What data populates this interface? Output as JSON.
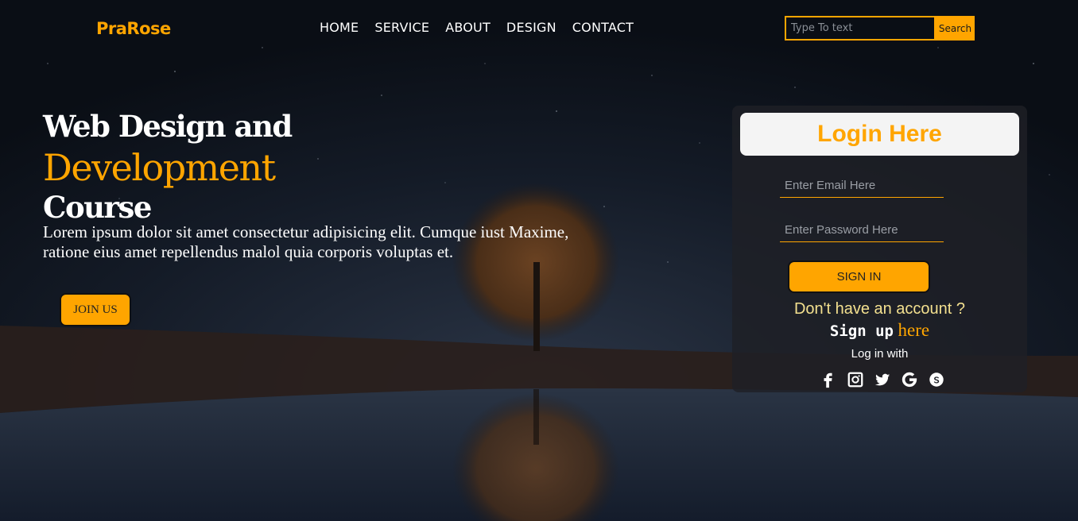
{
  "brand": {
    "logo": "PraRose",
    "accent": "#ffa500"
  },
  "nav": {
    "items": [
      "HOME",
      "SERVICE",
      "ABOUT",
      "DESIGN",
      "CONTACT"
    ]
  },
  "search": {
    "placeholder": "Type To text",
    "button": "Search"
  },
  "hero": {
    "line1": "Web Design and",
    "line2": "Development",
    "line3": "Course",
    "paragraph": "Lorem ipsum dolor sit amet consectetur adipisicing elit. Cumque iust Maxime, ratione eius amet repellendus malol quia corporis voluptas et.",
    "cta": "JOIN US"
  },
  "login": {
    "title": "Login Here",
    "email_placeholder": "Enter Email Here",
    "password_placeholder": "Enter Password Here",
    "submit": "SIGN IN",
    "no_account": "Don't have an account ?",
    "signup_text": "Sign up",
    "signup_link": "here",
    "login_with": "Log in with",
    "social_icons": [
      "facebook-icon",
      "instagram-icon",
      "twitter-icon",
      "google-icon",
      "skype-icon"
    ]
  }
}
